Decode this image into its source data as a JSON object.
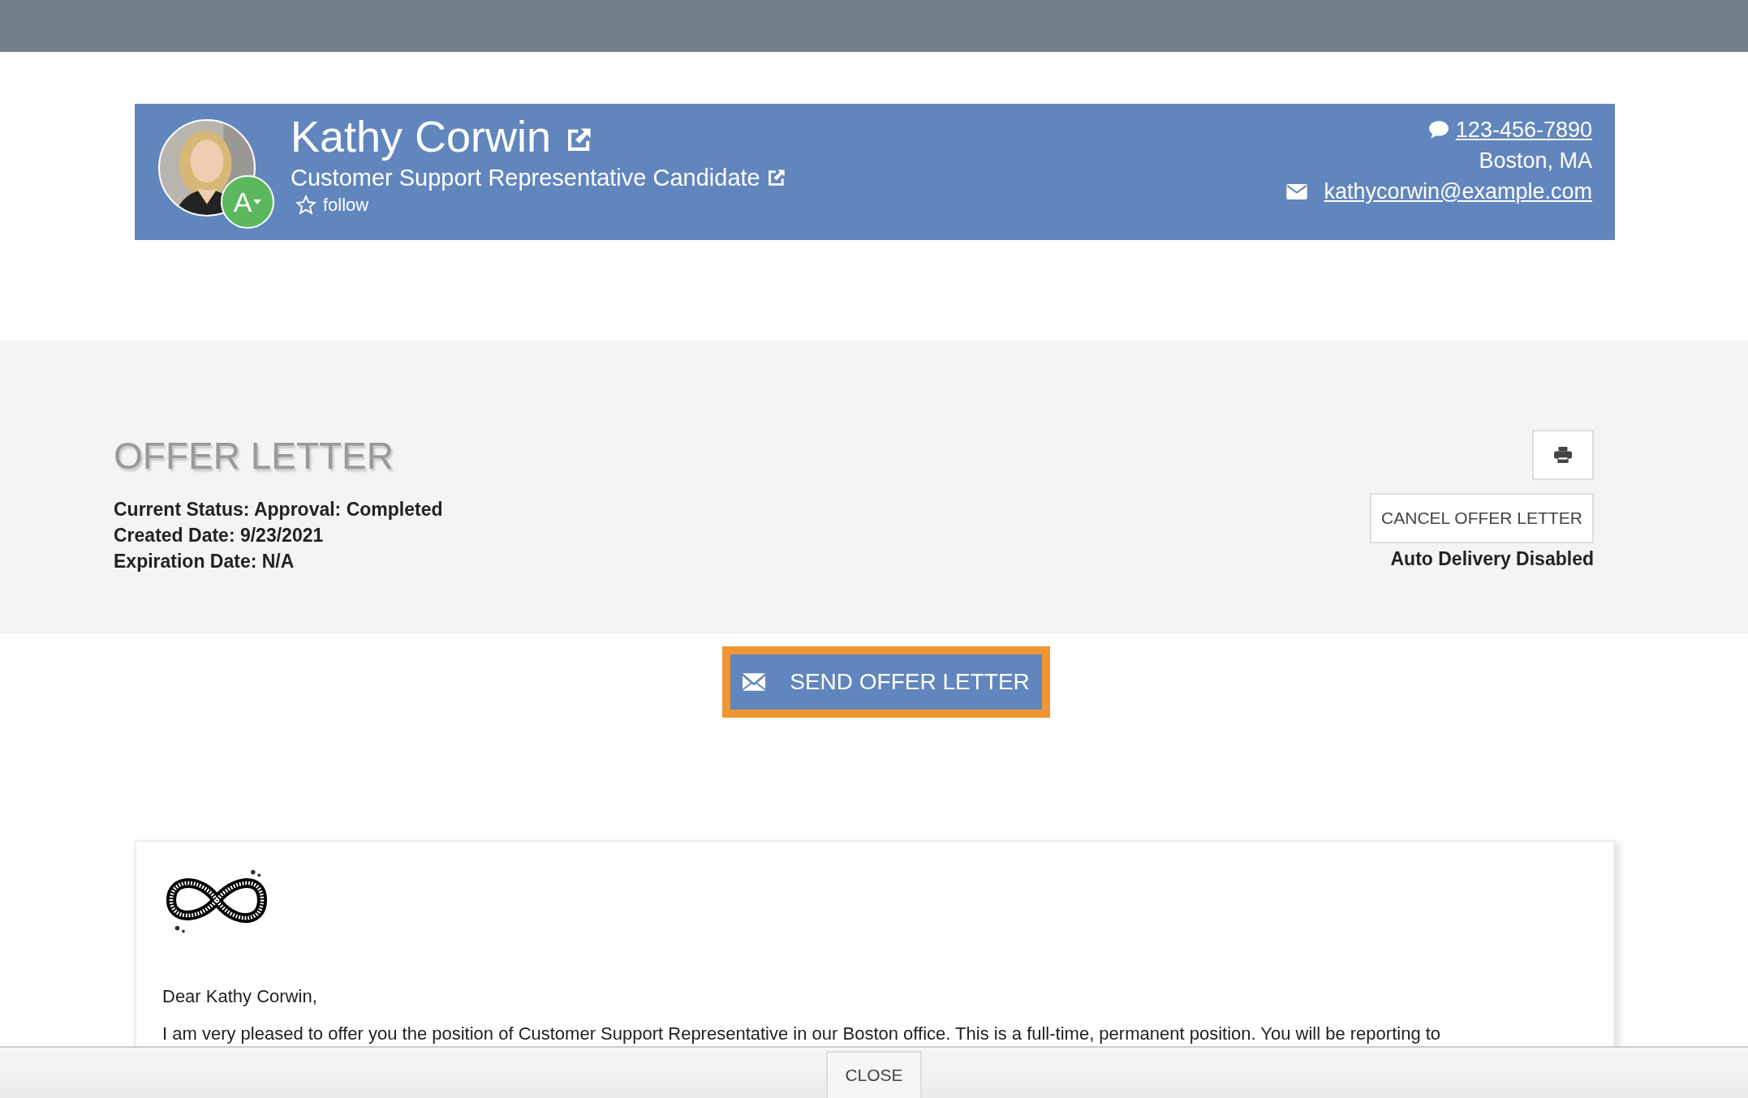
{
  "candidate": {
    "name": "Kathy Corwin",
    "title": "Customer Support Representative Candidate",
    "badge": "A",
    "follow": "follow",
    "phone": "123-456-7890",
    "location": "Boston, MA",
    "email": "kathycorwin@example.com"
  },
  "offer": {
    "heading": "OFFER LETTER",
    "details": [
      "Current Status: Approval: Completed",
      "Created Date: 9/23/2021",
      "Expiration Date: N/A"
    ],
    "cancel_button": "CANCEL OFFER LETTER",
    "delivery_note": "Auto Delivery Disabled"
  },
  "send_button": "SEND OFFER LETTER",
  "letter": {
    "greeting": "Dear Kathy Corwin,",
    "body": "I am very pleased to offer you the position of Customer Support Representative in our Boston office. This is a full-time, permanent position. You will be reporting to"
  },
  "footer": {
    "close_button": "CLOSE"
  }
}
